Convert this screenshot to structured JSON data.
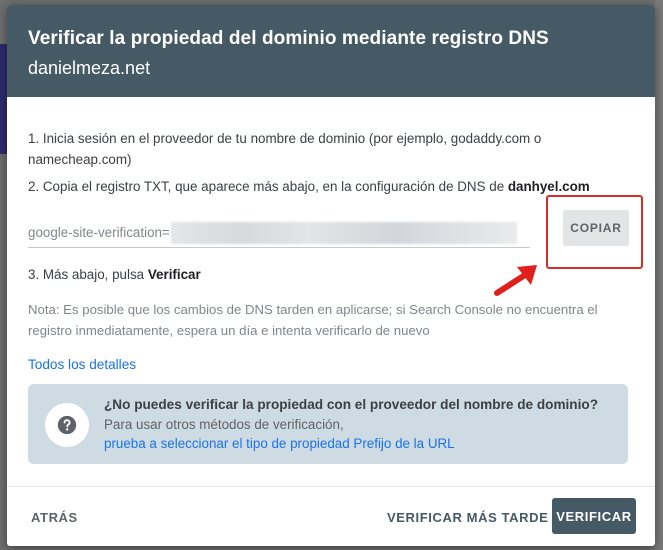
{
  "dialog": {
    "title": "Verificar la propiedad del dominio mediante registro DNS",
    "subtitle": "danielmeza.net"
  },
  "steps": {
    "step1": "1. Inicia sesión en el proveedor de tu nombre de dominio (por ejemplo, godaddy.com o namecheap.com)",
    "step2_prefix": "2. Copia el registro TXT, que aparece más abajo, en la configuración de DNS de ",
    "step2_domain": "danhyel.com",
    "step3_prefix": "3. Más abajo, pulsa ",
    "step3_action": "Verificar"
  },
  "txt_record": {
    "prefix": "google-site-verification="
  },
  "copy_button": {
    "label": "COPIAR"
  },
  "note": "Nota: Es posible que los cambios de DNS tarden en aplicarse; si Search Console no encuentra el registro inmediatamente, espera un día e intenta verificarlo de nuevo",
  "details_link": "Todos los detalles",
  "alt_card": {
    "title": "¿No puedes verificar la propiedad con el proveedor del nombre de dominio?",
    "subtitle": "Para usar otros métodos de verificación,",
    "link": "prueba a seleccionar el tipo de propiedad Prefijo de la URL",
    "icon": "help-icon"
  },
  "footer": {
    "back": "ATRÁS",
    "later": "VERIFICAR MÁS TARDE",
    "verify": "VERIFICAR"
  },
  "colors": {
    "header": "#455a64",
    "link": "#1a73e8",
    "card": "#cfdbe2",
    "highlight": "#d32f2f"
  }
}
